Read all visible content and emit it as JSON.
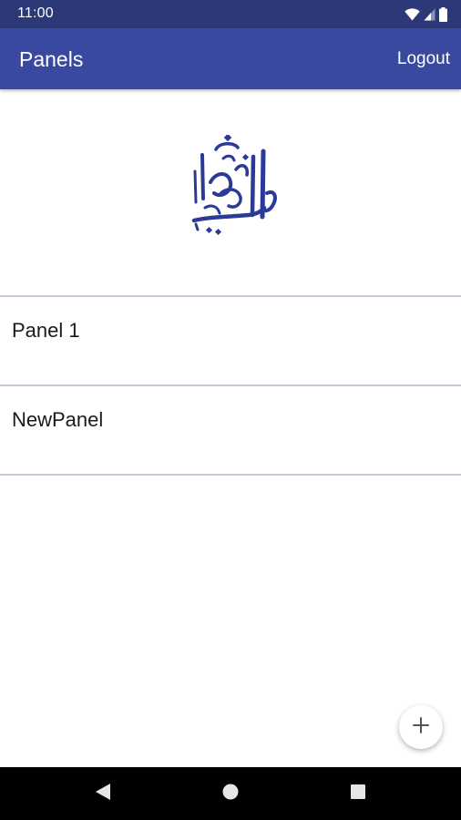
{
  "status_bar": {
    "time": "11:00",
    "icons": [
      "wifi-icon",
      "signal-icon",
      "battery-icon"
    ]
  },
  "app_bar": {
    "title": "Panels",
    "logout_label": "Logout"
  },
  "logo": {
    "icon": "calligraphy-logo"
  },
  "panels": [
    {
      "label": "Panel 1"
    },
    {
      "label": "NewPanel"
    }
  ],
  "fab": {
    "icon": "plus-icon"
  },
  "nav_bar": {
    "icons": [
      "back-icon",
      "home-icon",
      "recents-icon"
    ]
  },
  "colors": {
    "status_bar": "#2d3878",
    "app_bar": "#3949a0",
    "logo": "#2b3a97",
    "divider": "#c7c7d9"
  }
}
